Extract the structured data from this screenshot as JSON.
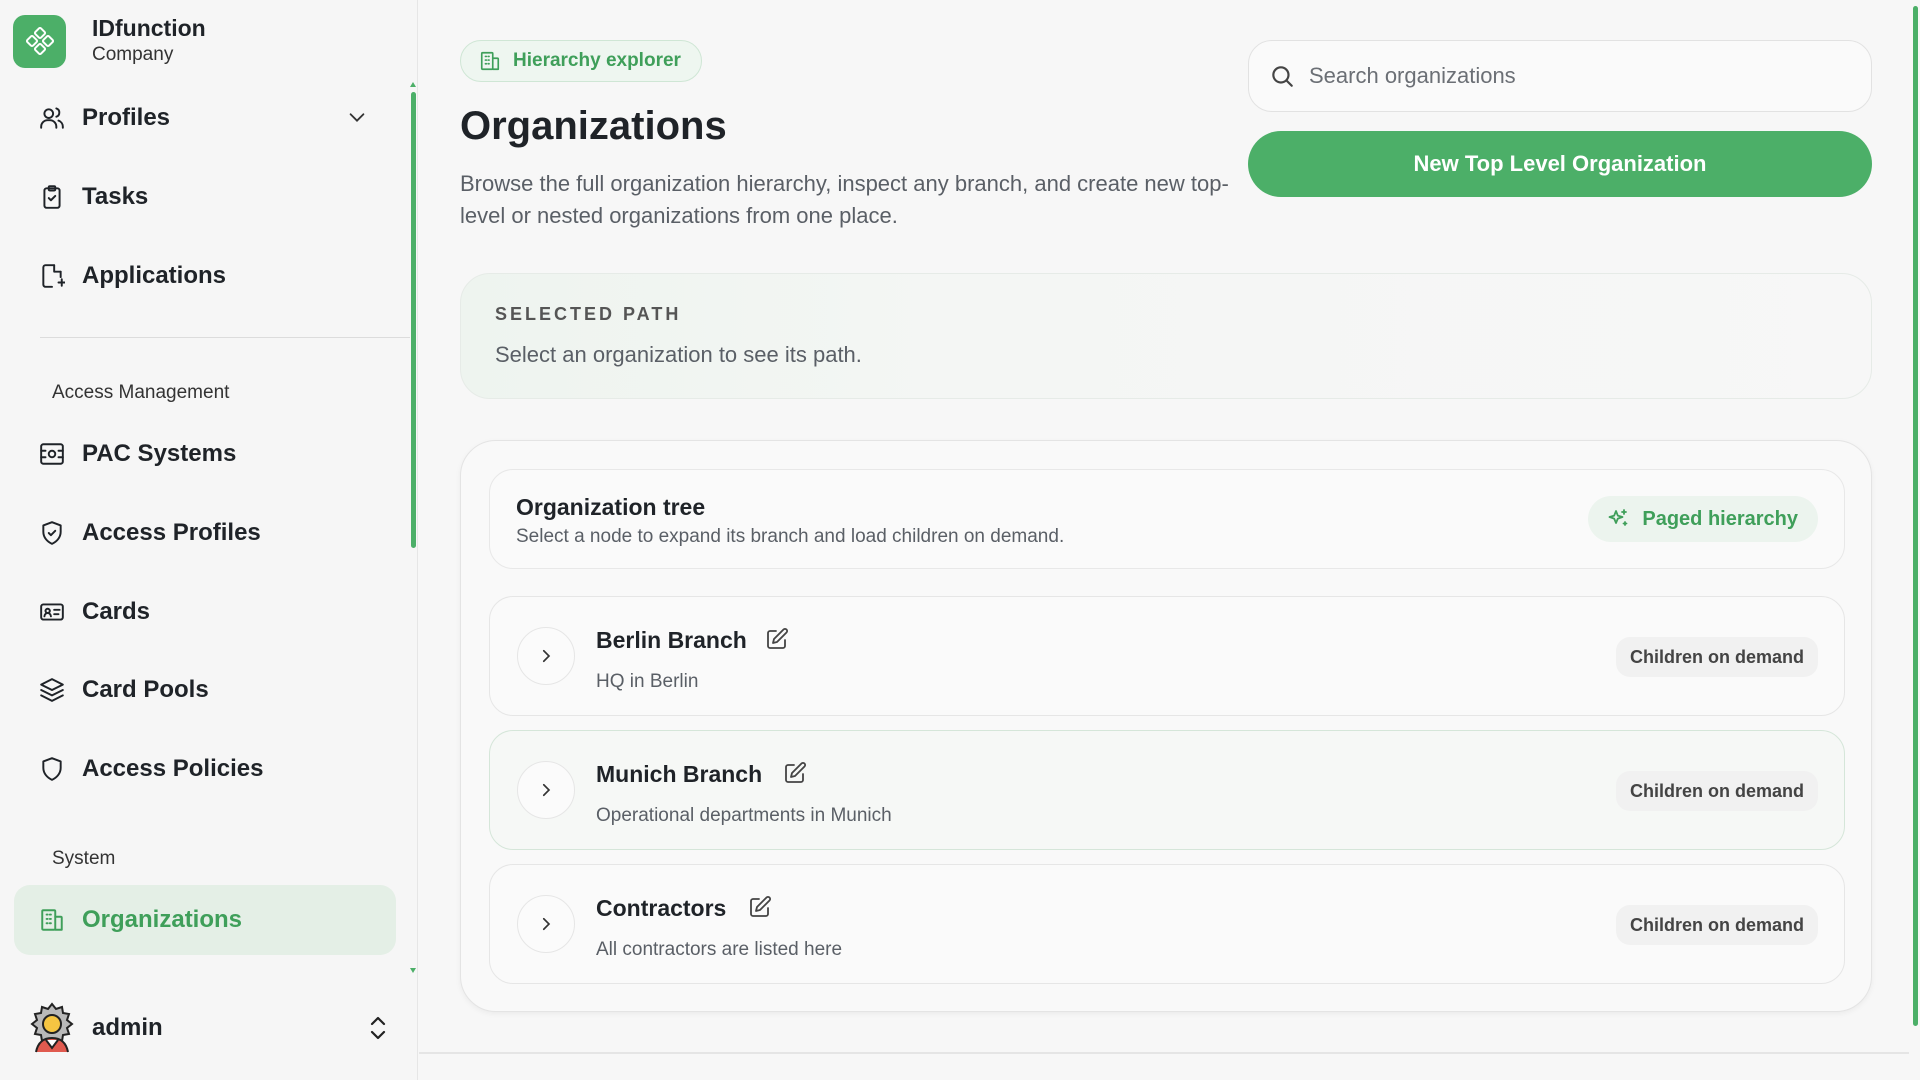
{
  "brand": {
    "name": "IDfunction",
    "subtitle": "Company"
  },
  "sidebar": {
    "items": [
      {
        "label": "Profiles",
        "icon": "users-icon",
        "has_children": true
      },
      {
        "label": "Tasks",
        "icon": "clipboard-check-icon"
      },
      {
        "label": "Applications",
        "icon": "file-plus-icon"
      }
    ],
    "sections": [
      {
        "label": "Access Management",
        "items": [
          {
            "label": "PAC Systems",
            "icon": "scan-face-icon"
          },
          {
            "label": "Access Profiles",
            "icon": "shield-check-icon"
          },
          {
            "label": "Cards",
            "icon": "id-card-icon"
          },
          {
            "label": "Card Pools",
            "icon": "layers-icon"
          },
          {
            "label": "Access Policies",
            "icon": "shield-icon"
          }
        ]
      },
      {
        "label": "System",
        "items": [
          {
            "label": "Organizations",
            "icon": "building-icon",
            "active": true
          }
        ]
      }
    ],
    "user": {
      "name": "admin",
      "avatar": "admin-avatar"
    }
  },
  "header": {
    "chip": "Hierarchy explorer",
    "title": "Organizations",
    "description": "Browse the full organization hierarchy, inspect any branch, and create new top-level or nested organizations from one place.",
    "search_placeholder": "Search organizations",
    "new_button": "New Top Level Organization"
  },
  "selected_path": {
    "label": "SELECTED PATH",
    "text": "Select an organization to see its path."
  },
  "tree": {
    "title": "Organization tree",
    "subtitle": "Select a node to expand its branch and load children on demand.",
    "chip": "Paged hierarchy",
    "rows": [
      {
        "name": "Berlin Branch",
        "description": "HQ in Berlin",
        "badge": "Children on demand"
      },
      {
        "name": "Munich Branch",
        "description": "Operational departments in Munich",
        "badge": "Children on demand"
      },
      {
        "name": "Contractors",
        "description": "All contractors are listed here",
        "badge": "Children on demand"
      }
    ]
  },
  "colors": {
    "accent": "#4caf68",
    "accent_text": "#3f9f5a",
    "active_bg": "#e4efe6"
  }
}
